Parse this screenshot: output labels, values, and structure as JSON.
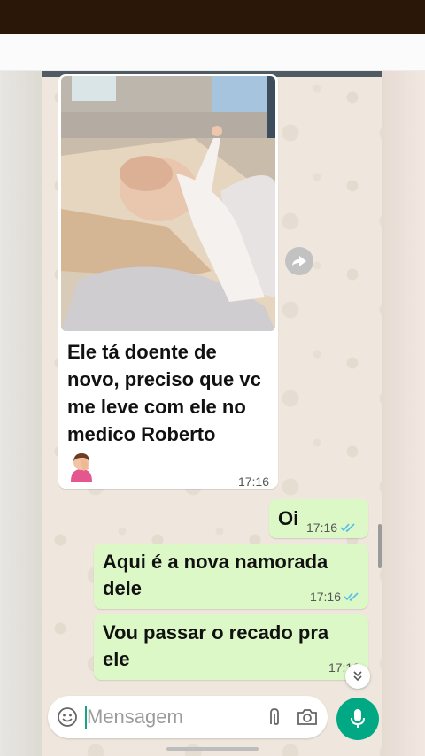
{
  "chat": {
    "incoming": {
      "text": "Ele tá doente de novo, preciso que vc me leve com ele no medico Roberto",
      "time": "17:16"
    },
    "outgoing": [
      {
        "text": "Oi",
        "time": "17:16",
        "status": "read"
      },
      {
        "text": "Aqui é a nova namorada dele",
        "time": "17:16",
        "status": "read"
      },
      {
        "text": "Vou passar o recado pra ele",
        "time": "17:16",
        "status": "read"
      }
    ]
  },
  "composer": {
    "placeholder": "Mensagem"
  },
  "colors": {
    "outgoing_bubble": "#dcf8c6",
    "incoming_bubble": "#ffffff",
    "accent": "#00a884",
    "read_ticks": "#53bdeb"
  },
  "icons": [
    "forward-icon",
    "scroll-down-icon",
    "emoji-icon",
    "attach-icon",
    "camera-icon",
    "mic-icon",
    "facepalm-emoji",
    "double-check-icon"
  ]
}
